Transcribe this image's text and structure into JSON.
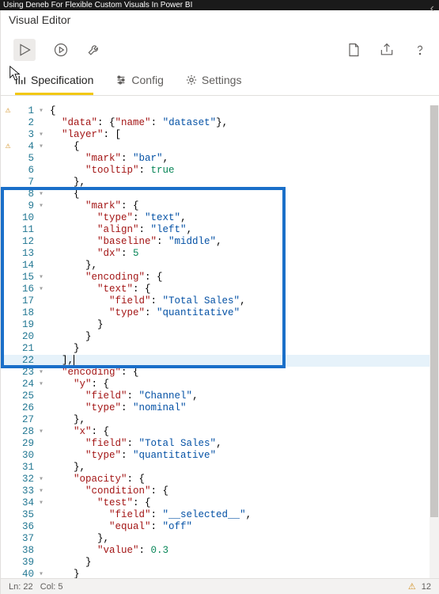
{
  "videoBanner": "Using Deneb For Flexible Custom Visuals In Power BI",
  "title": "Visual Editor",
  "tabs": {
    "spec": "Specification",
    "config": "Config",
    "settings": "Settings"
  },
  "code": {
    "lines": [
      {
        "n": 1,
        "warn": true,
        "fold": "▾",
        "ind": 0,
        "tokens": [
          [
            "p",
            "{"
          ]
        ]
      },
      {
        "n": 2,
        "ind": 2,
        "tokens": [
          [
            "k",
            "\"data\""
          ],
          [
            "p",
            ": {"
          ],
          [
            "k",
            "\"name\""
          ],
          [
            "p",
            ": "
          ],
          [
            "s",
            "\"dataset\""
          ],
          [
            "p",
            "},"
          ]
        ]
      },
      {
        "n": 3,
        "fold": "▾",
        "ind": 2,
        "tokens": [
          [
            "k",
            "\"layer\""
          ],
          [
            "p",
            ": ["
          ]
        ]
      },
      {
        "n": 4,
        "warn": true,
        "fold": "▾",
        "ind": 4,
        "tokens": [
          [
            "p",
            "{"
          ]
        ]
      },
      {
        "n": 5,
        "ind": 6,
        "tokens": [
          [
            "k",
            "\"mark\""
          ],
          [
            "p",
            ": "
          ],
          [
            "s",
            "\"bar\""
          ],
          [
            "p",
            ","
          ]
        ]
      },
      {
        "n": 6,
        "ind": 6,
        "tokens": [
          [
            "k",
            "\"tooltip\""
          ],
          [
            "p",
            ": "
          ],
          [
            "n",
            "true"
          ]
        ]
      },
      {
        "n": 7,
        "ind": 4,
        "tokens": [
          [
            "p",
            "},"
          ]
        ]
      },
      {
        "n": 8,
        "fold": "▾",
        "ind": 4,
        "tokens": [
          [
            "p",
            "{"
          ]
        ]
      },
      {
        "n": 9,
        "fold": "▾",
        "ind": 6,
        "tokens": [
          [
            "k",
            "\"mark\""
          ],
          [
            "p",
            ": {"
          ]
        ]
      },
      {
        "n": 10,
        "ind": 8,
        "tokens": [
          [
            "k",
            "\"type\""
          ],
          [
            "p",
            ": "
          ],
          [
            "s",
            "\"text\""
          ],
          [
            "p",
            ","
          ]
        ]
      },
      {
        "n": 11,
        "ind": 8,
        "tokens": [
          [
            "k",
            "\"align\""
          ],
          [
            "p",
            ": "
          ],
          [
            "s",
            "\"left\""
          ],
          [
            "p",
            ","
          ]
        ]
      },
      {
        "n": 12,
        "ind": 8,
        "tokens": [
          [
            "k",
            "\"baseline\""
          ],
          [
            "p",
            ": "
          ],
          [
            "s",
            "\"middle\""
          ],
          [
            "p",
            ","
          ]
        ]
      },
      {
        "n": 13,
        "ind": 8,
        "tokens": [
          [
            "k",
            "\"dx\""
          ],
          [
            "p",
            ": "
          ],
          [
            "n",
            "5"
          ]
        ]
      },
      {
        "n": 14,
        "ind": 6,
        "tokens": [
          [
            "p",
            "},"
          ]
        ]
      },
      {
        "n": 15,
        "fold": "▾",
        "ind": 6,
        "tokens": [
          [
            "k",
            "\"encoding\""
          ],
          [
            "p",
            ": {"
          ]
        ]
      },
      {
        "n": 16,
        "fold": "▾",
        "ind": 8,
        "tokens": [
          [
            "k",
            "\"text\""
          ],
          [
            "p",
            ": {"
          ]
        ]
      },
      {
        "n": 17,
        "ind": 10,
        "tokens": [
          [
            "k",
            "\"field\""
          ],
          [
            "p",
            ": "
          ],
          [
            "s",
            "\"Total Sales\""
          ],
          [
            "p",
            ","
          ]
        ]
      },
      {
        "n": 18,
        "ind": 10,
        "tokens": [
          [
            "k",
            "\"type\""
          ],
          [
            "p",
            ": "
          ],
          [
            "s",
            "\"quantitative\""
          ]
        ]
      },
      {
        "n": 19,
        "ind": 8,
        "tokens": [
          [
            "p",
            "}"
          ]
        ]
      },
      {
        "n": 20,
        "ind": 6,
        "tokens": [
          [
            "p",
            "}"
          ]
        ]
      },
      {
        "n": 21,
        "ind": 4,
        "tokens": [
          [
            "p",
            "}"
          ]
        ]
      },
      {
        "n": 22,
        "current": true,
        "ind": 2,
        "tokens": [
          [
            "p",
            "],"
          ]
        ],
        "cursor": true
      },
      {
        "n": 23,
        "fold": "▾",
        "ind": 2,
        "tokens": [
          [
            "k",
            "\"encoding\""
          ],
          [
            "p",
            ": {"
          ]
        ]
      },
      {
        "n": 24,
        "fold": "▾",
        "ind": 4,
        "tokens": [
          [
            "k",
            "\"y\""
          ],
          [
            "p",
            ": {"
          ]
        ]
      },
      {
        "n": 25,
        "ind": 6,
        "tokens": [
          [
            "k",
            "\"field\""
          ],
          [
            "p",
            ": "
          ],
          [
            "s",
            "\"Channel\""
          ],
          [
            "p",
            ","
          ]
        ]
      },
      {
        "n": 26,
        "ind": 6,
        "tokens": [
          [
            "k",
            "\"type\""
          ],
          [
            "p",
            ": "
          ],
          [
            "s",
            "\"nominal\""
          ]
        ]
      },
      {
        "n": 27,
        "ind": 4,
        "tokens": [
          [
            "p",
            "},"
          ]
        ]
      },
      {
        "n": 28,
        "fold": "▾",
        "ind": 4,
        "tokens": [
          [
            "k",
            "\"x\""
          ],
          [
            "p",
            ": {"
          ]
        ]
      },
      {
        "n": 29,
        "ind": 6,
        "tokens": [
          [
            "k",
            "\"field\""
          ],
          [
            "p",
            ": "
          ],
          [
            "s",
            "\"Total Sales\""
          ],
          [
            "p",
            ","
          ]
        ]
      },
      {
        "n": 30,
        "ind": 6,
        "tokens": [
          [
            "k",
            "\"type\""
          ],
          [
            "p",
            ": "
          ],
          [
            "s",
            "\"quantitative\""
          ]
        ]
      },
      {
        "n": 31,
        "ind": 4,
        "tokens": [
          [
            "p",
            "},"
          ]
        ]
      },
      {
        "n": 32,
        "fold": "▾",
        "ind": 4,
        "tokens": [
          [
            "k",
            "\"opacity\""
          ],
          [
            "p",
            ": {"
          ]
        ]
      },
      {
        "n": 33,
        "fold": "▾",
        "ind": 6,
        "tokens": [
          [
            "k",
            "\"condition\""
          ],
          [
            "p",
            ": {"
          ]
        ]
      },
      {
        "n": 34,
        "fold": "▾",
        "ind": 8,
        "tokens": [
          [
            "k",
            "\"test\""
          ],
          [
            "p",
            ": {"
          ]
        ]
      },
      {
        "n": 35,
        "ind": 10,
        "tokens": [
          [
            "k",
            "\"field\""
          ],
          [
            "p",
            ": "
          ],
          [
            "s",
            "\"__selected__\""
          ],
          [
            "p",
            ","
          ]
        ]
      },
      {
        "n": 36,
        "ind": 10,
        "tokens": [
          [
            "k",
            "\"equal\""
          ],
          [
            "p",
            ": "
          ],
          [
            "s",
            "\"off\""
          ]
        ]
      },
      {
        "n": 37,
        "ind": 8,
        "tokens": [
          [
            "p",
            "},"
          ]
        ]
      },
      {
        "n": 38,
        "ind": 8,
        "tokens": [
          [
            "k",
            "\"value\""
          ],
          [
            "p",
            ": "
          ],
          [
            "n",
            "0.3"
          ]
        ]
      },
      {
        "n": 39,
        "ind": 6,
        "tokens": [
          [
            "p",
            "}"
          ]
        ]
      },
      {
        "n": 40,
        "fold": "▾",
        "ind": 4,
        "tokens": [
          [
            "p",
            "}"
          ]
        ]
      }
    ]
  },
  "status": {
    "ln": "Ln: 22",
    "col": "Col: 5",
    "warnCount": "12"
  },
  "highlight": {
    "topLine": 8,
    "bottomLine": 22
  }
}
